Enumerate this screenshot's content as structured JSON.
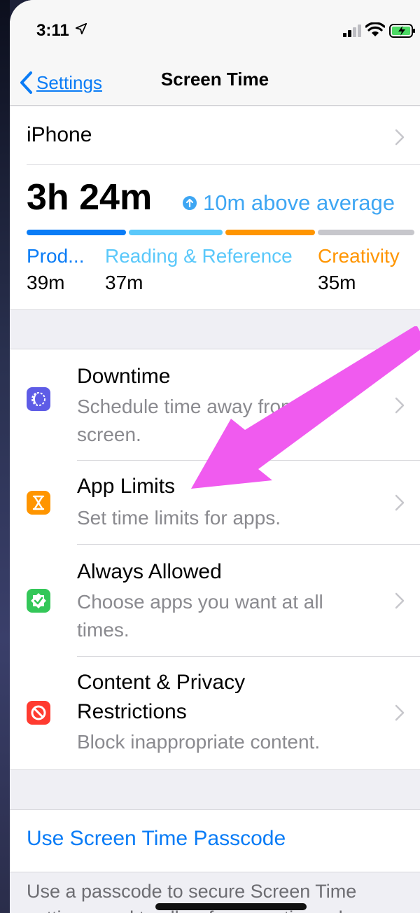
{
  "status_bar": {
    "time": "3:11"
  },
  "nav": {
    "back_label": "Settings",
    "title": "Screen Time"
  },
  "summary": {
    "device": "iPhone",
    "total": "3h 24m",
    "trend": "10m above average",
    "categories": [
      {
        "name": "Prod...",
        "time": "39m",
        "color": "#0a7cf6"
      },
      {
        "name": "Reading & Reference",
        "time": "37m",
        "color": "#5ac8fa"
      },
      {
        "name": "Creativity",
        "time": "35m",
        "color": "#ff9500"
      }
    ],
    "usage_bar": [
      0.27,
      0.25,
      0.24,
      0.24
    ]
  },
  "items": [
    {
      "title": "Downtime",
      "subtitle": "Schedule time away from the screen.",
      "icon": "downtime-icon",
      "color": "#5e5ce6"
    },
    {
      "title": "App Limits",
      "subtitle": "Set time limits for apps.",
      "icon": "hourglass-icon",
      "color": "#ff9500"
    },
    {
      "title": "Always Allowed",
      "subtitle": "Choose apps you want at all times.",
      "icon": "checkmark-seal-icon",
      "color": "#34c759"
    },
    {
      "title": "Content & Privacy Restrictions",
      "subtitle": "Block inappropriate content.",
      "icon": "restrictions-icon",
      "color": "#ff3b30"
    }
  ],
  "passcode": {
    "label": "Use Screen Time Passcode"
  },
  "footer": {
    "text": "Use a passcode to secure Screen Time settings, and to allow for more time when"
  },
  "annotation": {
    "arrow_color": "#f05bef"
  }
}
